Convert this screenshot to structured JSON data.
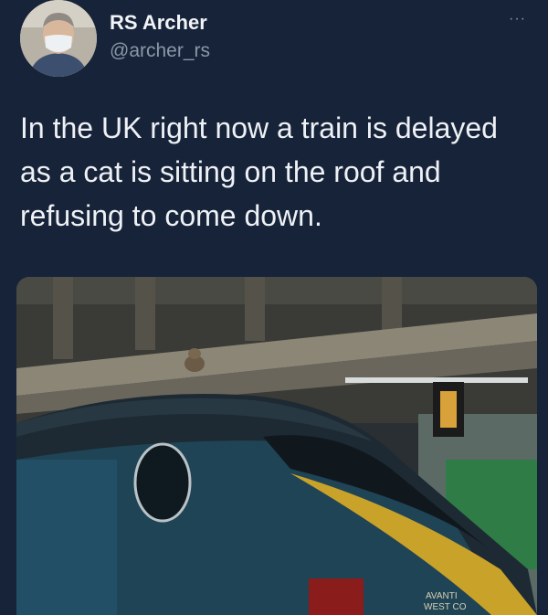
{
  "tweet": {
    "display_name": "RS Archer",
    "handle": "@archer_rs",
    "more_label": "···",
    "text": "In the UK right now a train is delayed as a cat is sitting on the roof and refusing to come down."
  },
  "media": {
    "train_livery_text_1": "AVANTI",
    "train_livery_text_2": "WEST CO"
  }
}
